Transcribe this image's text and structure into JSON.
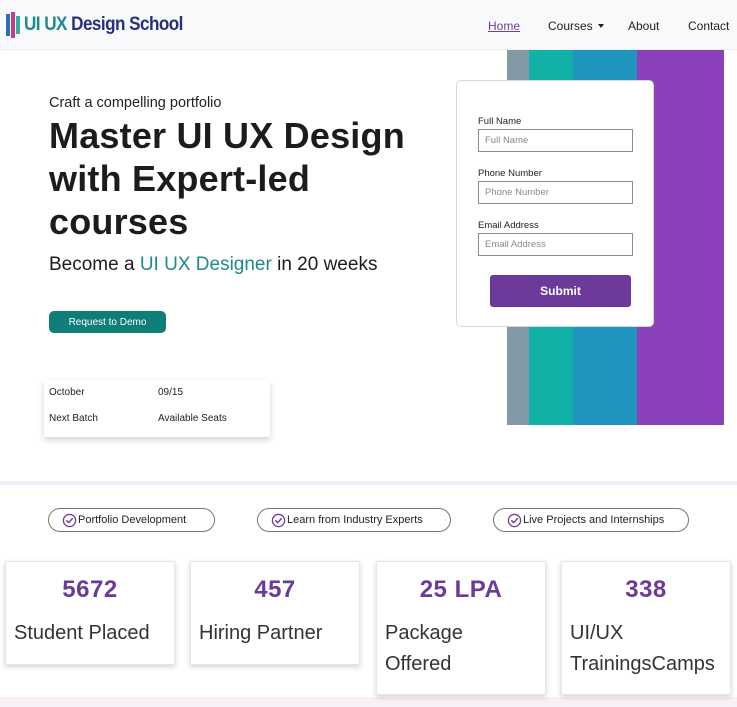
{
  "brand": {
    "name_prefix": "UI UX",
    "name_suffix": " Design School"
  },
  "nav": {
    "home": "Home",
    "courses": "Courses",
    "about": "About",
    "contact": "Contact"
  },
  "hero": {
    "eyebrow": "Craft a compelling portfolio",
    "headline": "Master UI UX Design with Expert-led courses",
    "subline_before": "Become a ",
    "subline_highlight": "UI UX Designer",
    "subline_after": " in 20 weeks",
    "cta": "Request to Demo"
  },
  "batch": {
    "month": "October",
    "date": "09/15",
    "next_batch": "Next Batch",
    "seats": "Available Seats"
  },
  "form": {
    "full_name_label": "Full Name",
    "full_name_placeholder": "Full Name",
    "phone_label": "Phone Number",
    "phone_placeholder": "Phone Number",
    "email_label": "Email Address",
    "email_placeholder": "Email Address",
    "submit": "Submit"
  },
  "features": [
    {
      "label": "Portfolio Development"
    },
    {
      "label": "Learn from Industry Experts"
    },
    {
      "label": "Live Projects and Internships"
    }
  ],
  "stats": [
    {
      "value": "5672",
      "label": "Student Placed"
    },
    {
      "value": "457",
      "label": "Hiring Partner"
    },
    {
      "value": "25 LPA",
      "label": "Package Offered"
    },
    {
      "value": "338",
      "label": "UI/UX TrainingsCamps"
    }
  ],
  "colors": {
    "accent_purple": "#6b3a9b",
    "accent_teal": "#0f7d78",
    "stripe_grey": "#8299a6",
    "stripe_teal": "#11b1a8",
    "stripe_blue": "#1f95bd",
    "stripe_purple": "#8a41b9"
  },
  "icons": {
    "feature_check": "check-circle-icon",
    "courses_dropdown": "caret-down-icon"
  }
}
